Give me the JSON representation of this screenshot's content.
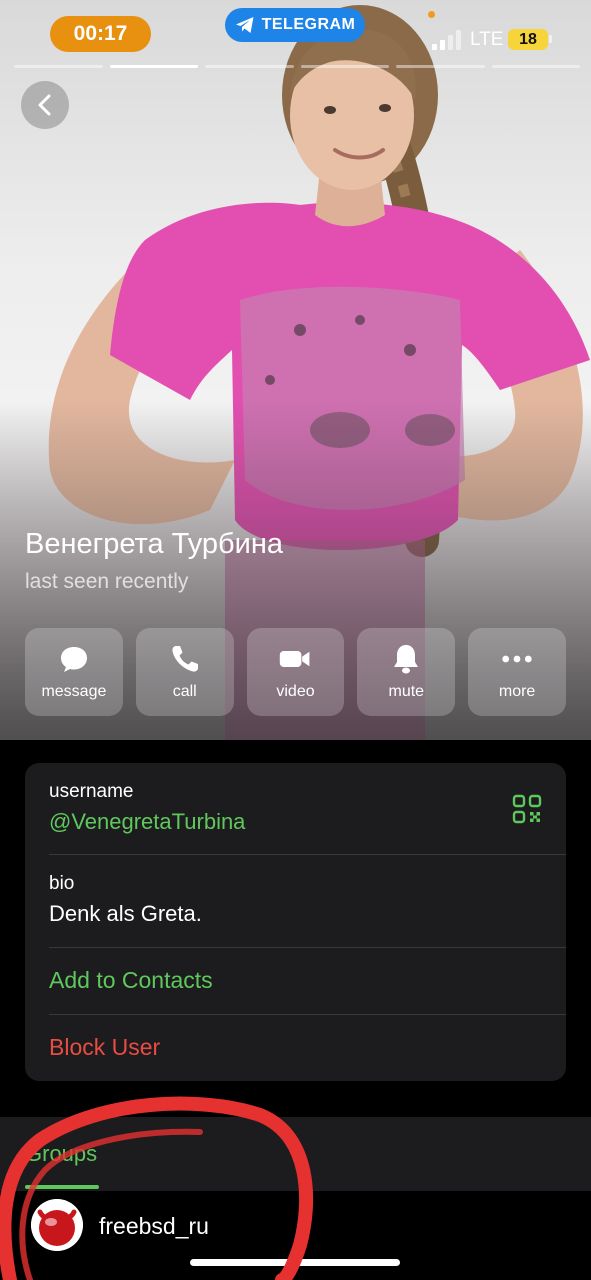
{
  "status_bar": {
    "time": "00:17",
    "source_app": "TELEGRAM",
    "network": "LTE",
    "battery": "18"
  },
  "profile": {
    "name": "Венегрета Турбина",
    "status": "last seen recently"
  },
  "actions": [
    {
      "label": "message",
      "icon": "message-bubble-icon"
    },
    {
      "label": "call",
      "icon": "phone-icon"
    },
    {
      "label": "video",
      "icon": "video-camera-icon"
    },
    {
      "label": "mute",
      "icon": "bell-icon"
    },
    {
      "label": "more",
      "icon": "more-dots-icon"
    }
  ],
  "info": {
    "username_label": "username",
    "username_value": "@VenegretaTurbina",
    "bio_label": "bio",
    "bio_value": "Denk als Greta.",
    "add_contact": "Add to Contacts",
    "block_user": "Block User"
  },
  "tab": {
    "label": "Groups"
  },
  "groups": [
    {
      "name": "freebsd_ru"
    }
  ],
  "colors": {
    "accent_green": "#5fc85c",
    "danger_red": "#ea4c43",
    "telegram_blue": "#1f84e8",
    "time_orange": "#e8900f",
    "annotation_red": "#e5312f"
  }
}
